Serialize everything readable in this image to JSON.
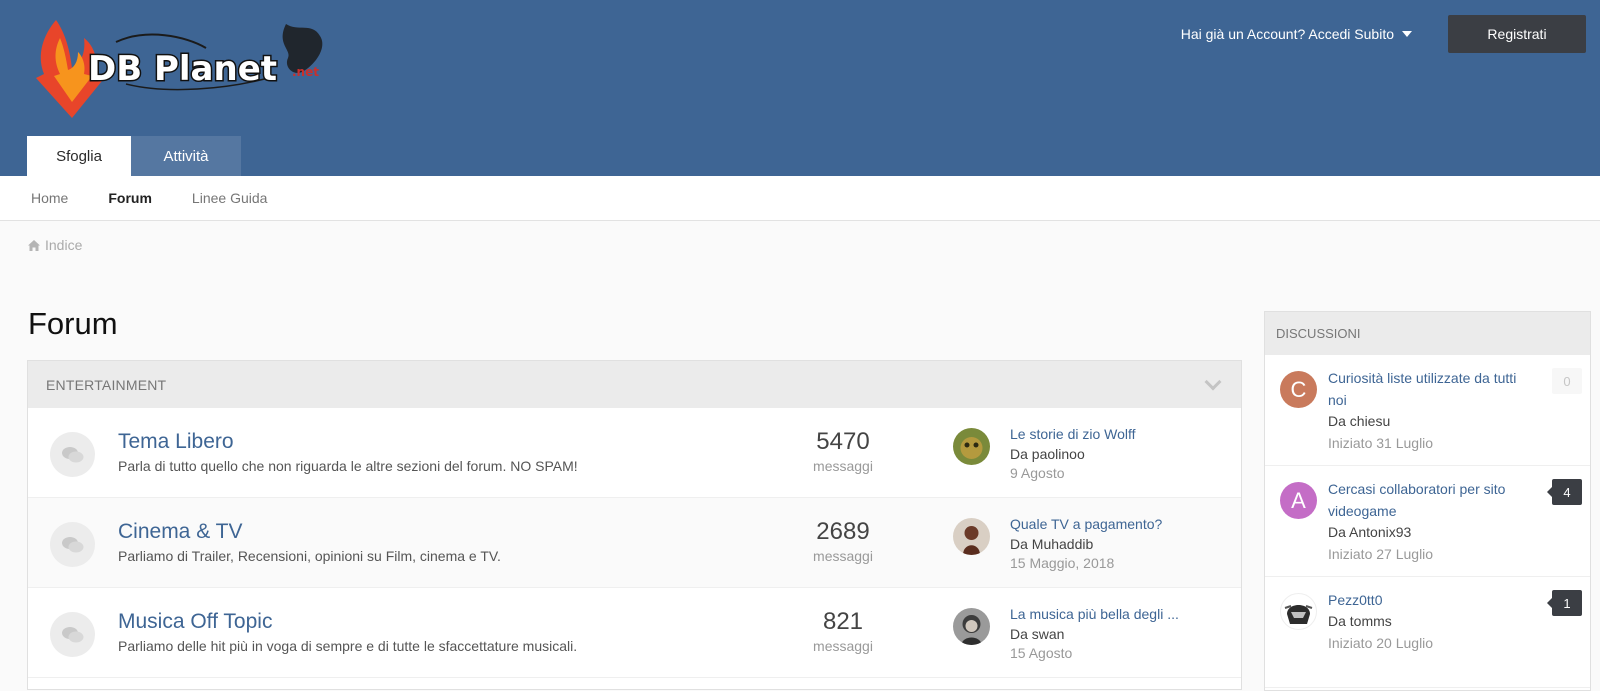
{
  "header": {
    "logo_name": "DB Planet",
    "logo_suffix": ".net",
    "signin_label": "Hai già un Account? Accedi Subito",
    "register_label": "Registrati",
    "tabs": [
      {
        "label": "Sfoglia",
        "active": true
      },
      {
        "label": "Attività",
        "active": false
      }
    ],
    "colors": {
      "bar": "#3e6594",
      "accent": "#3e6594"
    }
  },
  "subnav": {
    "items": [
      {
        "label": "Home"
      },
      {
        "label": "Forum",
        "active": true
      },
      {
        "label": "Linee Guida"
      }
    ]
  },
  "breadcrumb": {
    "label": "Indice",
    "icon": "home-icon"
  },
  "page": {
    "title": "Forum"
  },
  "category": {
    "title": "ENTERTAINMENT",
    "forums": [
      {
        "name": "Tema Libero",
        "description": "Parla di tutto quello che non riguarda le altre sezioni del forum. NO SPAM!",
        "count": "5470",
        "count_label": "messaggi",
        "last_topic": "Le storie di zio Wolff",
        "last_by": "Da paolinoo",
        "last_date": "9 Agosto"
      },
      {
        "name": "Cinema & TV",
        "description": "Parliamo di Trailer, Recensioni, opinioni su Film, cinema e TV.",
        "count": "2689",
        "count_label": "messaggi",
        "last_topic": "Quale TV a pagamento?",
        "last_by": "Da Muhaddib",
        "last_date": "15 Maggio, 2018"
      },
      {
        "name": "Musica Off Topic",
        "description": "Parliamo delle hit più in voga di sempre e di tutte le sfaccettature musicali.",
        "count": "821",
        "count_label": "messaggi",
        "last_topic": "La musica più bella degli ...",
        "last_by": "Da swan",
        "last_date": "15 Agosto"
      }
    ]
  },
  "sidebar": {
    "title": "DISCUSSIONI",
    "items": [
      {
        "initial": "C",
        "avatar_color": "#c97a5c",
        "title": "Curiosità liste utilizzate da tutti noi",
        "by": "Da chiesu",
        "date": "Iniziato 31 Luglio",
        "replies": "0"
      },
      {
        "initial": "A",
        "avatar_color": "#c46dc6",
        "title": "Cercasi collaboratori per sito videogame",
        "by": "Da Antonix93",
        "date": "Iniziato 27 Luglio",
        "replies": "4"
      },
      {
        "initial": "",
        "avatar_color": "#ffffff",
        "title": "Pezz0tt0",
        "by": "Da tomms",
        "date": "Iniziato 20 Luglio",
        "replies": "1"
      }
    ]
  }
}
